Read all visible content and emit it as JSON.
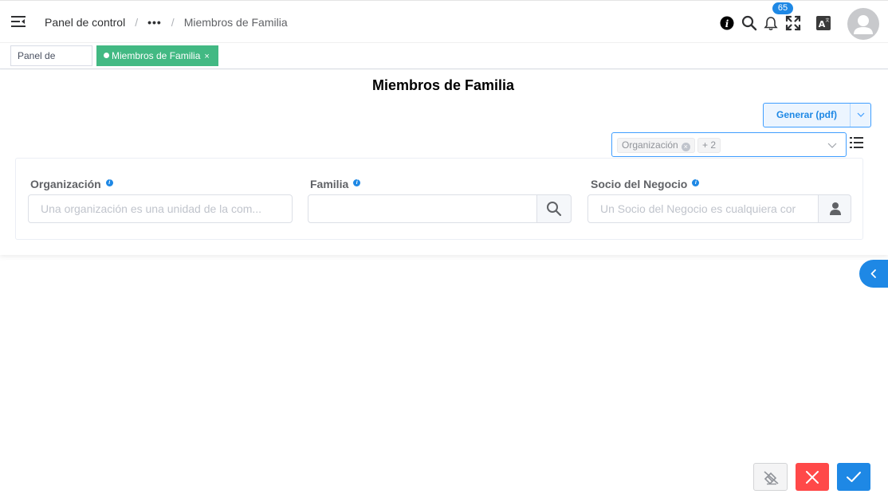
{
  "header": {
    "breadcrumb": [
      "Panel de control",
      "•••",
      "Miembros de Familia"
    ],
    "separator": "/",
    "notification_count": "65",
    "icons": [
      "menu-collapse-icon",
      "info-icon",
      "search-icon",
      "bell-icon",
      "fullscreen-icon",
      "language-icon",
      "user-avatar-icon"
    ]
  },
  "tabs": [
    {
      "label": "Panel de control",
      "active": false
    },
    {
      "label": "Miembros de Familia",
      "active": true,
      "close": "×"
    }
  ],
  "panel": {
    "title": "Miembros de Familia",
    "generate_label": "Generar (pdf)",
    "column_selector": {
      "chips": [
        "Organización",
        "+ 2"
      ]
    }
  },
  "fields": [
    {
      "label": "Organización",
      "placeholder": "Una organización es una unidad de la com...",
      "value": ""
    },
    {
      "label": "Familia",
      "placeholder": "",
      "value": ""
    },
    {
      "label": "Socio del Negocio",
      "placeholder": "Un Socio del Negocio es cualquiera cor",
      "value": ""
    }
  ],
  "colors": {
    "accent": "#1e88e5",
    "tab_active": "#42b983",
    "cancel": "#ff4949",
    "confirm": "#1e88e5"
  }
}
